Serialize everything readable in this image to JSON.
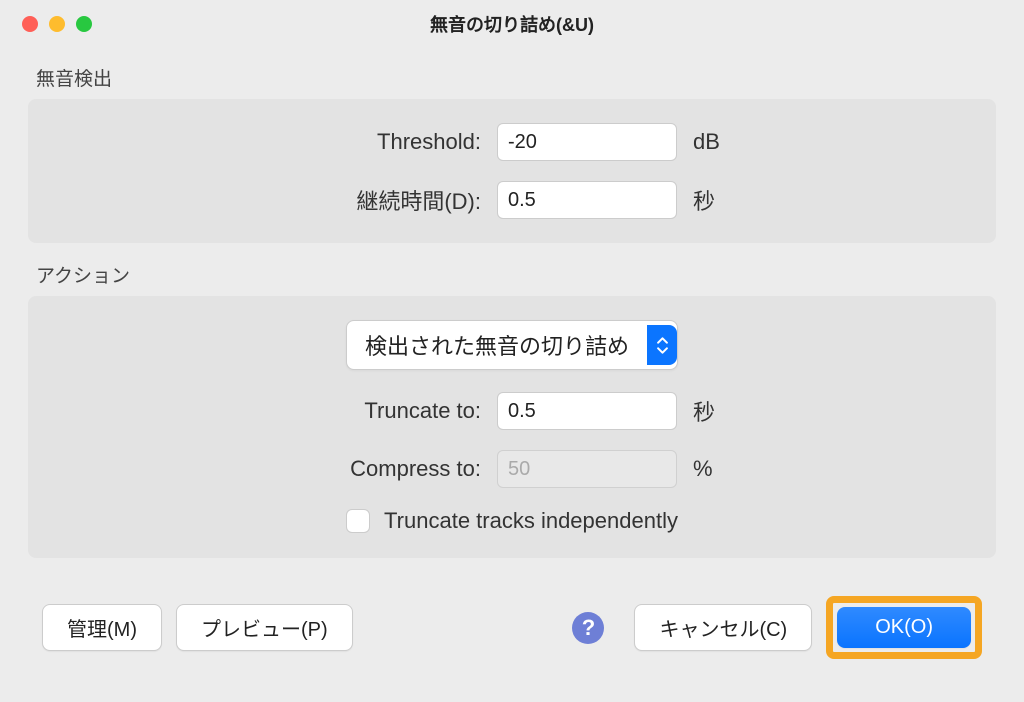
{
  "window": {
    "title": "無音の切り詰め(&U)"
  },
  "detection": {
    "section_label": "無音検出",
    "threshold_label": "Threshold:",
    "threshold_value": "-20",
    "threshold_unit": "dB",
    "duration_label": "継続時間(D):",
    "duration_value": "0.5",
    "duration_unit": "秒"
  },
  "action": {
    "section_label": "アクション",
    "select_label": "検出された無音の切り詰め",
    "truncate_label": "Truncate to:",
    "truncate_value": "0.5",
    "truncate_unit": "秒",
    "compress_label": "Compress to:",
    "compress_value": "50",
    "compress_unit": "%",
    "checkbox_label": "Truncate tracks independently"
  },
  "buttons": {
    "manage": "管理(M)",
    "preview": "プレビュー(P)",
    "help": "?",
    "cancel": "キャンセル(C)",
    "ok": "OK(O)"
  }
}
